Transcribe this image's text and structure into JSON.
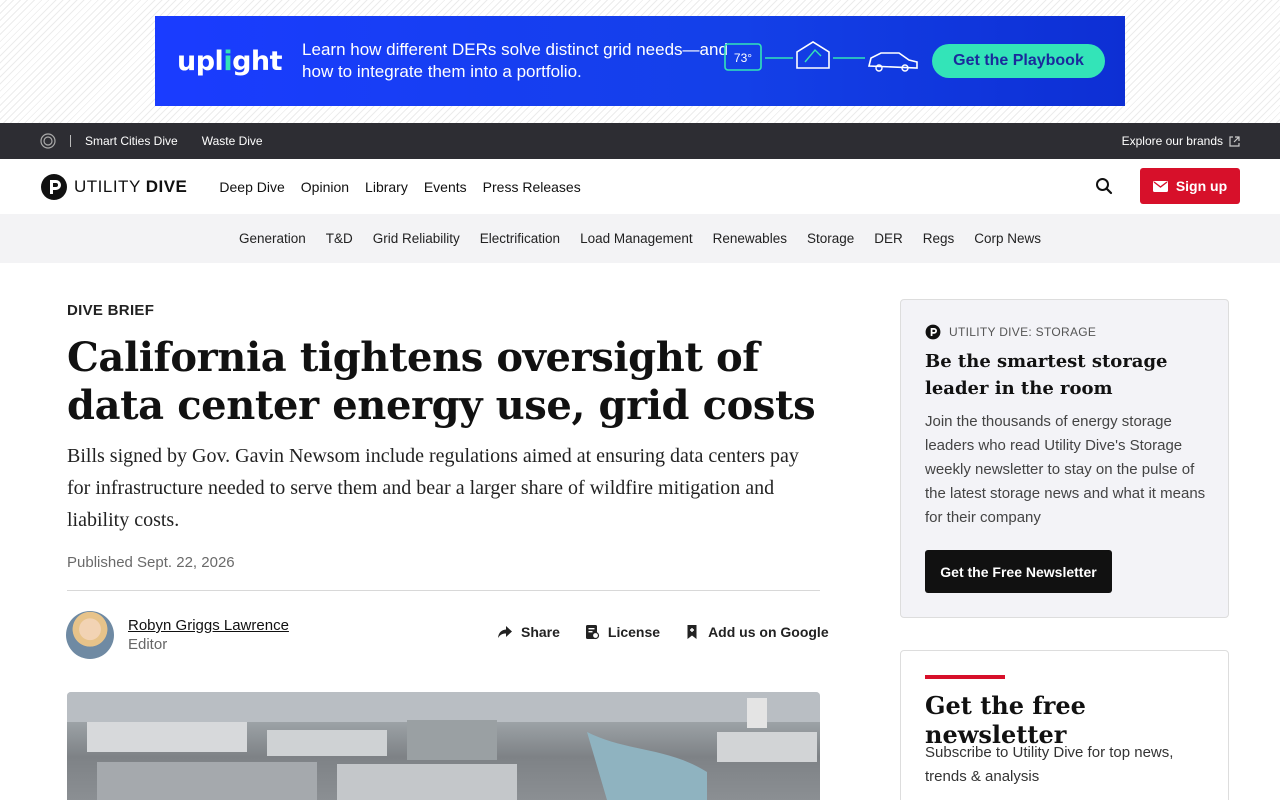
{
  "ad": {
    "logo_pre": "upl",
    "logo_g": "i",
    "logo_post": "ght",
    "text": "Learn how different DERs solve distinct grid needs—and how to integrate them into a portfolio.",
    "thermostat_value": "73°",
    "cta": "Get the Playbook",
    "colors": {
      "background": "#1a3cff",
      "accent": "#33e4b8"
    }
  },
  "network_bar": {
    "brands": [
      "Smart Cities Dive",
      "Waste Dive"
    ],
    "explore": "Explore our brands"
  },
  "header": {
    "logo_light": "UTILITY",
    "logo_bold": "DIVE",
    "nav": [
      "Deep Dive",
      "Opinion",
      "Library",
      "Events",
      "Press Releases"
    ],
    "signup": "Sign up"
  },
  "topics": [
    "Generation",
    "T&D",
    "Grid Reliability",
    "Electrification",
    "Load Management",
    "Renewables",
    "Storage",
    "DER",
    "Regs",
    "Corp News"
  ],
  "article": {
    "kicker": "DIVE BRIEF",
    "headline": "California tightens oversight of data center energy use, grid costs",
    "dek": "Bills signed by Gov. Gavin Newsom include regulations aimed at ensuring data centers pay for infrastructure needed to serve them and bear a larger share of wildfire mitigation and liability costs.",
    "published": "Published Sept. 22, 2026",
    "author": {
      "name": "Robyn Griggs Lawrence",
      "role": "Editor"
    },
    "actions": {
      "share": "Share",
      "license": "License",
      "google": "Add us on Google"
    }
  },
  "sidebar": {
    "promo": {
      "eyebrow": "UTILITY DIVE: STORAGE",
      "title": "Be the smartest storage leader in the room",
      "body": "Join the thousands of energy storage leaders who read Utility Dive's Storage weekly newsletter to stay on the pulse of the latest storage news and what it means for their company",
      "cta": "Get the Free Newsletter"
    },
    "newsletter": {
      "title": "Get the free newsletter",
      "body": "Subscribe to Utility Dive for top news, trends & analysis"
    }
  },
  "colors": {
    "brand_red": "#d7102a",
    "dark_bar": "#2d2d33"
  }
}
